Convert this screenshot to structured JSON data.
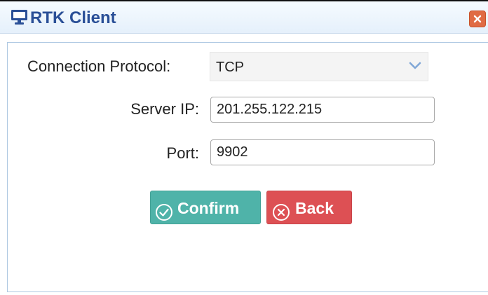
{
  "window": {
    "title": "RTK Client",
    "icon": "monitor-icon",
    "close_icon": "close-icon"
  },
  "form": {
    "protocol": {
      "label": "Connection Protocol:",
      "value": "TCP",
      "icon": "chevron-down-icon"
    },
    "server_ip": {
      "label": "Server IP:",
      "value": "201.255.122.215"
    },
    "port": {
      "label": "Port:",
      "value": "9902"
    }
  },
  "buttons": {
    "confirm": {
      "label": "Confirm",
      "icon": "check-circle-icon",
      "color": "#4fb3a9"
    },
    "back": {
      "label": "Back",
      "icon": "x-circle-icon",
      "color": "#dd5054"
    }
  },
  "colors": {
    "title_text": "#2a4f97",
    "close_button": "#e06b44",
    "panel_border": "#aec8e2"
  }
}
